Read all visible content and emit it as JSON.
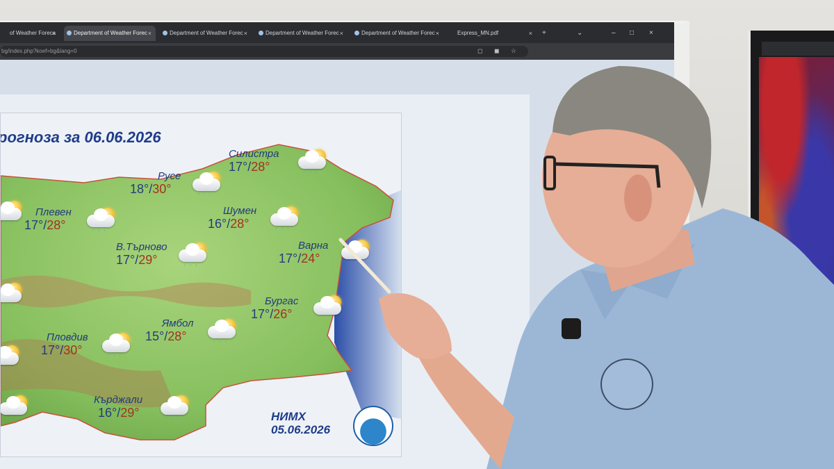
{
  "browser": {
    "tabs": [
      {
        "label": "of Weather Foreca",
        "close": "×"
      },
      {
        "label": "Department of Weather Forec",
        "close": "×",
        "active": true
      },
      {
        "label": "Department of Weather Forec",
        "close": "×"
      },
      {
        "label": "Department of Weather Forec",
        "close": "×"
      },
      {
        "label": "Department of Weather Forec",
        "close": "×"
      },
      {
        "label": "Express_MN.pdf",
        "close": "×"
      }
    ],
    "new_tab": "+",
    "address": "bg/index.php?koef=bg&lang=0",
    "window_buttons": {
      "list": "⌄",
      "minimize": "–",
      "maximize": "□",
      "close": "×"
    }
  },
  "map": {
    "title": "рогноза за 06.06.2026",
    "cities": [
      {
        "name": "Силистра",
        "tmin": "17°",
        "tmax": "28°"
      },
      {
        "name": "Русе",
        "tmin": "18°",
        "tmax": "30°"
      },
      {
        "name": "Плевен",
        "tmin": "17°",
        "tmax": "28°"
      },
      {
        "name": "Шумен",
        "tmin": "16°",
        "tmax": "28°"
      },
      {
        "name": "В.Търново",
        "tmin": "17°",
        "tmax": "29°"
      },
      {
        "name": "Варна",
        "tmin": "17°",
        "tmax": "24°"
      },
      {
        "name": "Бургас",
        "tmin": "17°",
        "tmax": "26°"
      },
      {
        "name": "Ямбол",
        "tmin": "15°",
        "tmax": "28°"
      },
      {
        "name": "Пловдив",
        "tmin": "17°",
        "tmax": "30°"
      },
      {
        "name": "Кърджали",
        "tmin": "16°",
        "tmax": "29°"
      }
    ],
    "temp_separator": "/",
    "issuer": "НИМХ",
    "issued_date": "05.06.2026",
    "colors": {
      "land": "#8fc46a",
      "sea": "#3d64b8",
      "title": "#1f3c88",
      "tmax": "#a3321f"
    }
  }
}
